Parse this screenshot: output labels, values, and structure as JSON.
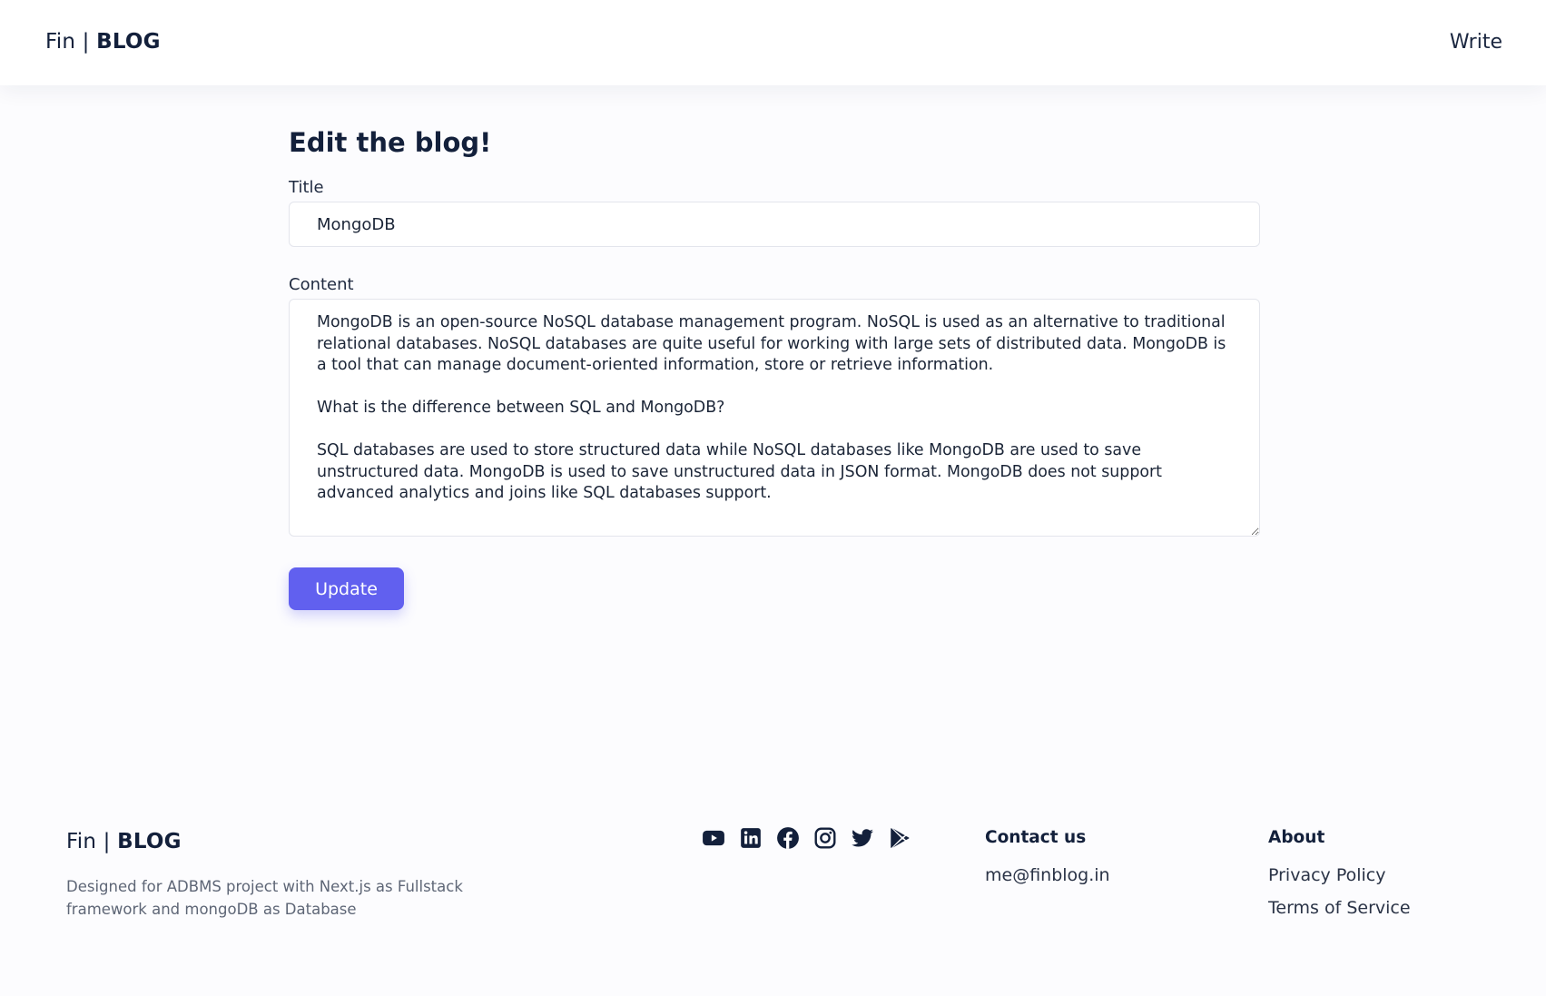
{
  "header": {
    "brand_prefix": "Fin | ",
    "brand_bold": "BLOG",
    "write_label": "Write"
  },
  "form": {
    "heading": "Edit the blog!",
    "title_label": "Title",
    "title_value": "MongoDB",
    "content_label": "Content",
    "content_value": "MongoDB is an open-source NoSQL database management program. NoSQL is used as an alternative to traditional relational databases. NoSQL databases are quite useful for working with large sets of distributed data. MongoDB is a tool that can manage document-oriented information, store or retrieve information.\n\nWhat is the difference between SQL and MongoDB?\n\nSQL databases are used to store structured data while NoSQL databases like MongoDB are used to save unstructured data. MongoDB is used to save unstructured data in JSON format. MongoDB does not support advanced analytics and joins like SQL databases support.",
    "update_label": "Update"
  },
  "footer": {
    "brand_prefix": "Fin | ",
    "brand_bold": "BLOG",
    "description": "Designed for ADBMS project with Next.js as Fullstack framework and mongoDB as Database",
    "socials": [
      "youtube-icon",
      "linkedin-icon",
      "facebook-icon",
      "instagram-icon",
      "twitter-icon",
      "play-store-icon"
    ],
    "contact": {
      "heading": "Contact us",
      "email": "me@finblog.in"
    },
    "about": {
      "heading": "About",
      "links": [
        "Privacy Policy",
        "Terms of Service"
      ]
    }
  },
  "colors": {
    "accent": "#6160ef",
    "text_dark": "#13203b",
    "page_bg": "#fcfcfe"
  }
}
